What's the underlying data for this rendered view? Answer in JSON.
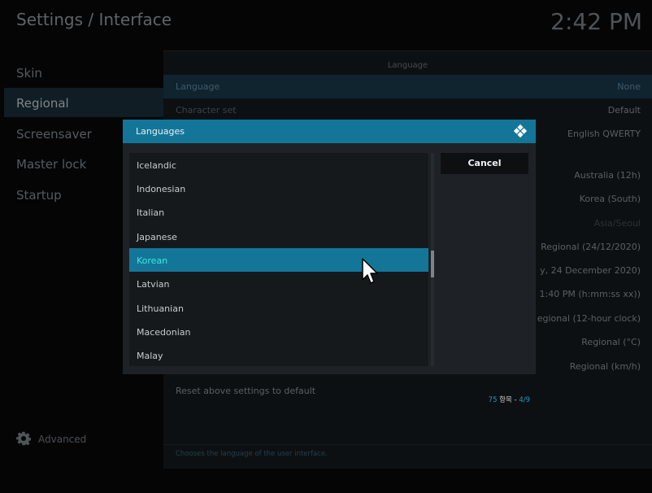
{
  "header": {
    "title": "Settings / Interface",
    "time": "2:42 PM"
  },
  "sidebar": {
    "items": [
      {
        "label": "Skin"
      },
      {
        "label": "Regional"
      },
      {
        "label": "Screensaver"
      },
      {
        "label": "Master lock"
      },
      {
        "label": "Startup"
      }
    ],
    "selected": "Regional",
    "advanced_label": "Advanced"
  },
  "main": {
    "section_title": "Language",
    "rows": [
      {
        "label": "Language",
        "value": "None"
      },
      {
        "label": "Character set",
        "value": "Default"
      },
      {
        "label": "",
        "value": "English QWERTY"
      },
      {
        "label": "",
        "value": "Australia (12h)"
      },
      {
        "label": "",
        "value": "Korea (South)"
      },
      {
        "label": "",
        "value": "Asia/Seoul"
      },
      {
        "label": "",
        "value": "Regional (24/12/2020)"
      },
      {
        "label": "",
        "value": "y, 24 December 2020)"
      },
      {
        "label": "",
        "value": "1:40 PM (h:mm:ss xx))"
      },
      {
        "label": "",
        "value": "egional (12-hour clock)"
      },
      {
        "label": "",
        "value": "Regional (°C)"
      },
      {
        "label": "",
        "value": "Regional (km/h)"
      }
    ],
    "reset_label": "Reset above settings to default",
    "description": "Chooses the language of the user interface."
  },
  "dialog": {
    "title": "Languages",
    "items": [
      "Icelandic",
      "Indonesian",
      "Italian",
      "Japanese",
      "Korean",
      "Latvian",
      "Lithuanian",
      "Macedonian",
      "Malay"
    ],
    "selected": "Korean",
    "cancel_label": "Cancel",
    "count": "75",
    "count_label": " 항목 - ",
    "page": "4/9"
  },
  "colors": {
    "accent": "#137699",
    "selected_text": "#3ee8d8",
    "background": "#050506"
  },
  "icons": [
    "gear-icon",
    "kodi-logo-icon",
    "mouse-cursor-icon"
  ]
}
